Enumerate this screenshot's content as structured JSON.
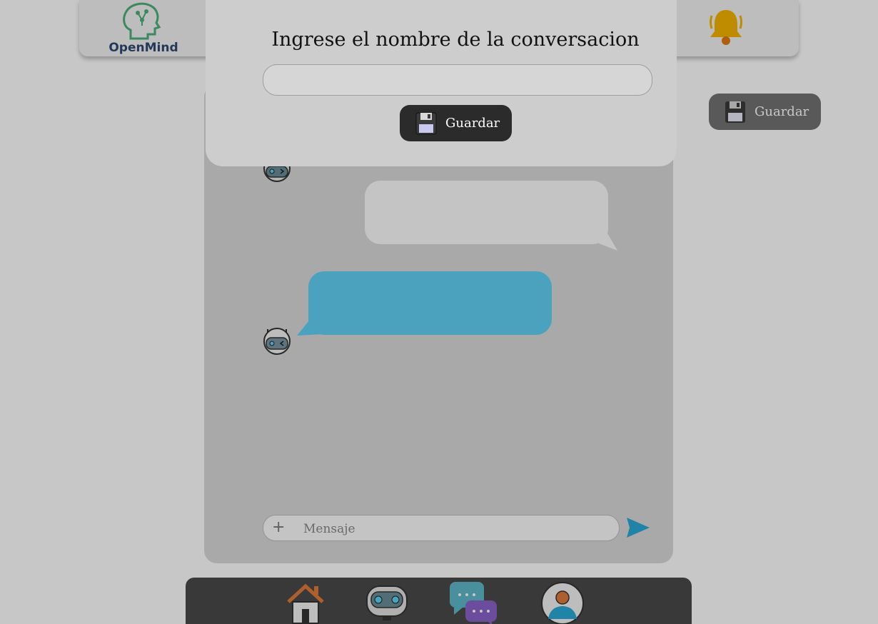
{
  "app": {
    "logo_text": "OpenMind"
  },
  "header": {
    "notification_icon": "bell-icon"
  },
  "side_actions": {
    "save_label": "Guardar",
    "save_icon": "floppy-disk-icon"
  },
  "chat": {
    "messages": [
      {
        "role": "user",
        "text": ""
      },
      {
        "role": "bot",
        "text": ""
      }
    ],
    "input": {
      "placeholder": "Mensaje",
      "value": "",
      "attach_icon": "plus-icon"
    },
    "send_icon": "send-arrow-icon"
  },
  "bottom_nav": {
    "items": [
      {
        "name": "home",
        "icon": "home-icon"
      },
      {
        "name": "bot",
        "icon": "robot-icon"
      },
      {
        "name": "conversations",
        "icon": "chat-bubbles-icon"
      },
      {
        "name": "profile",
        "icon": "user-profile-icon"
      }
    ]
  },
  "modal": {
    "title": "Ingrese el nombre de la conversacion",
    "input_value": "",
    "save_label": "Guardar",
    "save_icon": "floppy-disk-icon"
  },
  "colors": {
    "accent_blue": "#5fd0f5",
    "bell": "#f5b400",
    "dark_button": "#2b2b2b",
    "logo_text": "#2f4a73"
  }
}
